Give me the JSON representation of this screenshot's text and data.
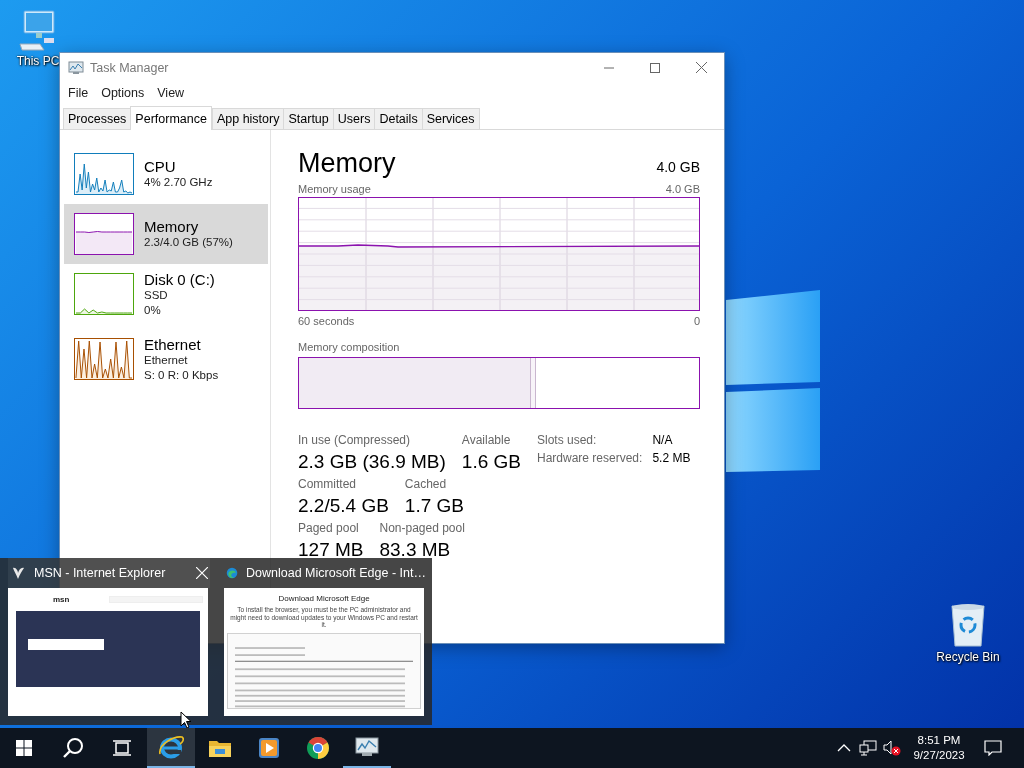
{
  "desktop_icons": [
    {
      "kind": "computer",
      "label": "This PC"
    },
    {
      "kind": "recycle_bin",
      "label": "Recycle Bin"
    }
  ],
  "task_manager": {
    "title": "Task Manager",
    "menu": [
      "File",
      "Options",
      "View"
    ],
    "tabs": [
      {
        "label": "Processes",
        "selected": false
      },
      {
        "label": "Performance",
        "selected": true
      },
      {
        "label": "App history",
        "selected": false
      },
      {
        "label": "Startup",
        "selected": false
      },
      {
        "label": "Users",
        "selected": false
      },
      {
        "label": "Details",
        "selected": false
      },
      {
        "label": "Services",
        "selected": false
      }
    ],
    "resources": [
      {
        "kind": "cpu",
        "name": "CPU",
        "details": [
          "4% 2.70 GHz"
        ],
        "color": "#117dbb",
        "selected": false
      },
      {
        "kind": "memory",
        "name": "Memory",
        "details": [
          "2.3/4.0 GB (57%)"
        ],
        "color": "#8b12ae",
        "selected": true
      },
      {
        "kind": "disk",
        "name": "Disk 0 (C:)",
        "details": [
          "SSD",
          "0%"
        ],
        "color": "#4da60c",
        "selected": false
      },
      {
        "kind": "ethernet",
        "name": "Ethernet",
        "details": [
          "Ethernet",
          "S: 0 R: 0 Kbps"
        ],
        "color": "#a74f01",
        "selected": false
      }
    ],
    "detail": {
      "title": "Memory",
      "total": "4.0 GB",
      "usage_label": "Memory usage",
      "usage_max": "4.0 GB",
      "time_span": "60 seconds",
      "time_end": "0",
      "composition_label": "Memory composition",
      "composition": [
        {
          "kind": "in_use",
          "level": 0.58
        },
        {
          "kind": "modified",
          "level": 0.012
        }
      ],
      "stats": [
        [
          {
            "label": "In use (Compressed)",
            "value": "2.3 GB (36.9 MB)"
          },
          {
            "label": "Available",
            "value": "1.6 GB"
          }
        ],
        [
          {
            "label": "Committed",
            "value": "2.2/5.4 GB"
          },
          {
            "label": "Cached",
            "value": "1.7 GB"
          }
        ],
        [
          {
            "label": "Paged pool",
            "value": "127 MB"
          },
          {
            "label": "Non-paged pool",
            "value": "83.3 MB"
          }
        ]
      ],
      "hardware": [
        {
          "label": "Slots used:",
          "value": "N/A"
        },
        {
          "label": "Hardware reserved:",
          "value": "5.2 MB"
        }
      ]
    }
  },
  "thumbnails": [
    {
      "kind": "msn",
      "title": "MSN - Internet Explorer",
      "selected": true,
      "texts": [
        "msn"
      ]
    },
    {
      "kind": "edge_download",
      "title": "Download Microsoft Edge - Int…",
      "selected": false,
      "texts": [
        "Download Microsoft Edge",
        "To install the browser, you must be the PC administrator and might need to download updates to your Windows PC and restart it."
      ]
    }
  ],
  "taskbar": {
    "items": [
      {
        "kind": "start"
      },
      {
        "kind": "search"
      },
      {
        "kind": "task_view"
      },
      {
        "kind": "ie",
        "running": true,
        "selected": true
      },
      {
        "kind": "explorer",
        "running": false,
        "selected": false
      },
      {
        "kind": "media_player",
        "running": false,
        "selected": false
      },
      {
        "kind": "chrome",
        "running": false,
        "selected": false
      },
      {
        "kind": "task_manager",
        "running": true,
        "selected": false
      }
    ],
    "tray": [
      {
        "kind": "chevron"
      },
      {
        "kind": "network"
      },
      {
        "kind": "volume_muted"
      }
    ],
    "time": "8:51 PM",
    "date": "9/27/2023"
  }
}
